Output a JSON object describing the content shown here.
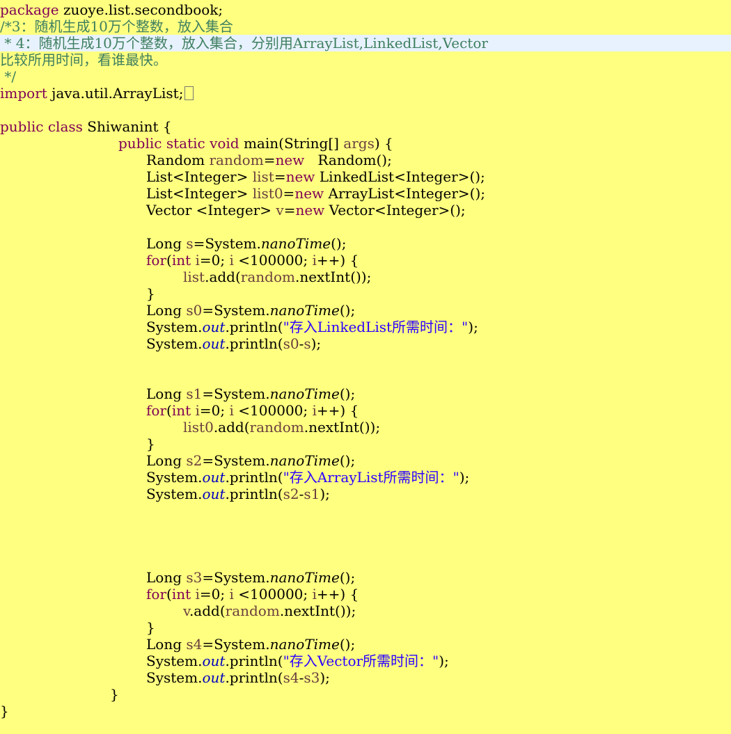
{
  "colors": {
    "background": "#ffff80",
    "keyword": "#7f0055",
    "comment": "#3f7f5f",
    "static_field": "#0000c0",
    "string": "#2a00ff",
    "local_variable": "#6a3e3e",
    "current_line": "#e8f2fe"
  },
  "code_lines": [
    {
      "indent": 0,
      "tokens": [
        [
          "kw",
          "package"
        ],
        [
          "",
          "zuoye.list.secondbook;"
        ]
      ]
    },
    {
      "indent": 0,
      "tokens": [
        [
          "cm",
          "/*3：随机生成10万个整数，放入集合"
        ]
      ]
    },
    {
      "indent": 0,
      "highlight": true,
      "tokens": [
        [
          "cm",
          " * 4：随机生成10万个整数，放入集合，分别用ArrayList,LinkedList,Vector"
        ]
      ]
    },
    {
      "indent": 0,
      "tokens": [
        [
          "cm",
          "比较所用时间，看谁最快。"
        ]
      ]
    },
    {
      "indent": 0,
      "tokens": [
        [
          "cm",
          " */"
        ]
      ]
    },
    {
      "indent": 0,
      "fold_icon": "folded-import-icon",
      "tokens": [
        [
          "kw",
          "import"
        ],
        [
          "",
          "java.util.ArrayList;"
        ]
      ]
    },
    {
      "indent": 0,
      "tokens": []
    },
    {
      "indent": 0,
      "tokens": [
        [
          "kw",
          "public"
        ],
        [
          "kw",
          "class"
        ],
        [
          "",
          "Shiwanint {"
        ]
      ]
    },
    {
      "indent": 170,
      "tokens": [
        [
          "kw",
          "public"
        ],
        [
          "kw",
          "static"
        ],
        [
          "kw",
          "void"
        ],
        [
          "",
          "main(String[]"
        ],
        [
          "var",
          "args"
        ],
        [
          "",
          ") {"
        ]
      ]
    },
    {
      "indent": 210,
      "tokens": [
        [
          "",
          "Random"
        ],
        [
          "var",
          "random"
        ],
        [
          "",
          "="
        ],
        [
          "kw",
          "new"
        ],
        [
          "",
          "  Random();"
        ]
      ]
    },
    {
      "indent": 210,
      "tokens": [
        [
          "",
          "List<Integer>"
        ],
        [
          "var",
          "list"
        ],
        [
          "",
          "="
        ],
        [
          "kw",
          "new"
        ],
        [
          "",
          "LinkedList<Integer>();"
        ]
      ]
    },
    {
      "indent": 210,
      "tokens": [
        [
          "",
          "List<Integer>"
        ],
        [
          "var",
          "list0"
        ],
        [
          "",
          "="
        ],
        [
          "kw",
          "new"
        ],
        [
          "",
          "ArrayList<Integer>();"
        ]
      ]
    },
    {
      "indent": 210,
      "tokens": [
        [
          "",
          "Vector <Integer>"
        ],
        [
          "var",
          "v"
        ],
        [
          "",
          "="
        ],
        [
          "kw",
          "new"
        ],
        [
          "",
          "Vector<Integer>();"
        ]
      ]
    },
    {
      "indent": 210,
      "tokens": []
    },
    {
      "indent": 210,
      "tokens": [
        [
          "",
          "Long"
        ],
        [
          "var",
          "s"
        ],
        [
          "",
          "=System."
        ],
        [
          "mth",
          "nanoTime"
        ],
        [
          "",
          "();"
        ]
      ]
    },
    {
      "indent": 210,
      "tokens": [
        [
          "kw",
          "for"
        ],
        [
          "",
          "("
        ],
        [
          "kw",
          "int"
        ],
        [
          "var",
          "i"
        ],
        [
          "",
          "=0;"
        ],
        [
          "var",
          "i"
        ],
        [
          "",
          "<100000;"
        ],
        [
          "var",
          "i"
        ],
        [
          "",
          "++) {"
        ]
      ]
    },
    {
      "indent": 263,
      "tokens": [
        [
          "var",
          "list"
        ],
        [
          "",
          ".add("
        ],
        [
          "var",
          "random"
        ],
        [
          "",
          ".nextInt());"
        ]
      ]
    },
    {
      "indent": 210,
      "tokens": [
        [
          "",
          "}"
        ]
      ]
    },
    {
      "indent": 210,
      "tokens": [
        [
          "",
          "Long"
        ],
        [
          "var",
          "s0"
        ],
        [
          "",
          "=System."
        ],
        [
          "mth",
          "nanoTime"
        ],
        [
          "",
          "();"
        ]
      ]
    },
    {
      "indent": 210,
      "tokens": [
        [
          "",
          "System."
        ],
        [
          "fld",
          "out"
        ],
        [
          "",
          ".println("
        ],
        [
          "str",
          "\"存入LinkedList所需时间：\""
        ],
        [
          "",
          ");"
        ]
      ]
    },
    {
      "indent": 210,
      "tokens": [
        [
          "",
          "System."
        ],
        [
          "fld",
          "out"
        ],
        [
          "",
          ".println("
        ],
        [
          "var",
          "s0"
        ],
        [
          "",
          "-"
        ],
        [
          "var",
          "s"
        ],
        [
          "",
          ");"
        ]
      ]
    },
    {
      "indent": 210,
      "tokens": []
    },
    {
      "indent": 210,
      "tokens": []
    },
    {
      "indent": 210,
      "tokens": [
        [
          "",
          "Long"
        ],
        [
          "var",
          "s1"
        ],
        [
          "",
          "=System."
        ],
        [
          "mth",
          "nanoTime"
        ],
        [
          "",
          "();"
        ]
      ]
    },
    {
      "indent": 210,
      "tokens": [
        [
          "kw",
          "for"
        ],
        [
          "",
          "("
        ],
        [
          "kw",
          "int"
        ],
        [
          "var",
          "i"
        ],
        [
          "",
          "=0;"
        ],
        [
          "var",
          "i"
        ],
        [
          "",
          "<100000;"
        ],
        [
          "var",
          "i"
        ],
        [
          "",
          "++) {"
        ]
      ]
    },
    {
      "indent": 263,
      "tokens": [
        [
          "var",
          "list0"
        ],
        [
          "",
          ".add("
        ],
        [
          "var",
          "random"
        ],
        [
          "",
          ".nextInt());"
        ]
      ]
    },
    {
      "indent": 210,
      "tokens": [
        [
          "",
          "}"
        ]
      ]
    },
    {
      "indent": 210,
      "tokens": [
        [
          "",
          "Long"
        ],
        [
          "var",
          "s2"
        ],
        [
          "",
          "=System."
        ],
        [
          "mth",
          "nanoTime"
        ],
        [
          "",
          "();"
        ]
      ]
    },
    {
      "indent": 210,
      "tokens": [
        [
          "",
          "System."
        ],
        [
          "fld",
          "out"
        ],
        [
          "",
          ".println("
        ],
        [
          "str",
          "\"存入ArrayList所需时间：\""
        ],
        [
          "",
          ");"
        ]
      ]
    },
    {
      "indent": 210,
      "tokens": [
        [
          "",
          "System."
        ],
        [
          "fld",
          "out"
        ],
        [
          "",
          ".println("
        ],
        [
          "var",
          "s2"
        ],
        [
          "",
          "-"
        ],
        [
          "var",
          "s1"
        ],
        [
          "",
          ");"
        ]
      ]
    },
    {
      "indent": 210,
      "tokens": []
    },
    {
      "indent": 210,
      "tokens": []
    },
    {
      "indent": 210,
      "tokens": []
    },
    {
      "indent": 210,
      "tokens": []
    },
    {
      "indent": 210,
      "tokens": [
        [
          "",
          "Long"
        ],
        [
          "var",
          "s3"
        ],
        [
          "",
          "=System."
        ],
        [
          "mth",
          "nanoTime"
        ],
        [
          "",
          "();"
        ]
      ]
    },
    {
      "indent": 210,
      "tokens": [
        [
          "kw",
          "for"
        ],
        [
          "",
          "("
        ],
        [
          "kw",
          "int"
        ],
        [
          "var",
          "i"
        ],
        [
          "",
          "=0;"
        ],
        [
          "var",
          "i"
        ],
        [
          "",
          "<100000;"
        ],
        [
          "var",
          "i"
        ],
        [
          "",
          "++) {"
        ]
      ]
    },
    {
      "indent": 263,
      "tokens": [
        [
          "var",
          "v"
        ],
        [
          "",
          ".add("
        ],
        [
          "var",
          "random"
        ],
        [
          "",
          ".nextInt());"
        ]
      ]
    },
    {
      "indent": 210,
      "tokens": [
        [
          "",
          "}"
        ]
      ]
    },
    {
      "indent": 210,
      "tokens": [
        [
          "",
          "Long"
        ],
        [
          "var",
          "s4"
        ],
        [
          "",
          "=System."
        ],
        [
          "mth",
          "nanoTime"
        ],
        [
          "",
          "();"
        ]
      ]
    },
    {
      "indent": 210,
      "tokens": [
        [
          "",
          "System."
        ],
        [
          "fld",
          "out"
        ],
        [
          "",
          ".println("
        ],
        [
          "str",
          "\"存入Vector所需时间：\""
        ],
        [
          "",
          ");"
        ]
      ]
    },
    {
      "indent": 210,
      "tokens": [
        [
          "",
          "System."
        ],
        [
          "fld",
          "out"
        ],
        [
          "",
          ".println("
        ],
        [
          "var",
          "s4"
        ],
        [
          "",
          "-"
        ],
        [
          "var",
          "s3"
        ],
        [
          "",
          ");"
        ]
      ]
    },
    {
      "indent": 158,
      "tokens": [
        [
          "",
          "}"
        ]
      ]
    },
    {
      "indent": 0,
      "tokens": [
        [
          "",
          "}"
        ]
      ]
    }
  ]
}
